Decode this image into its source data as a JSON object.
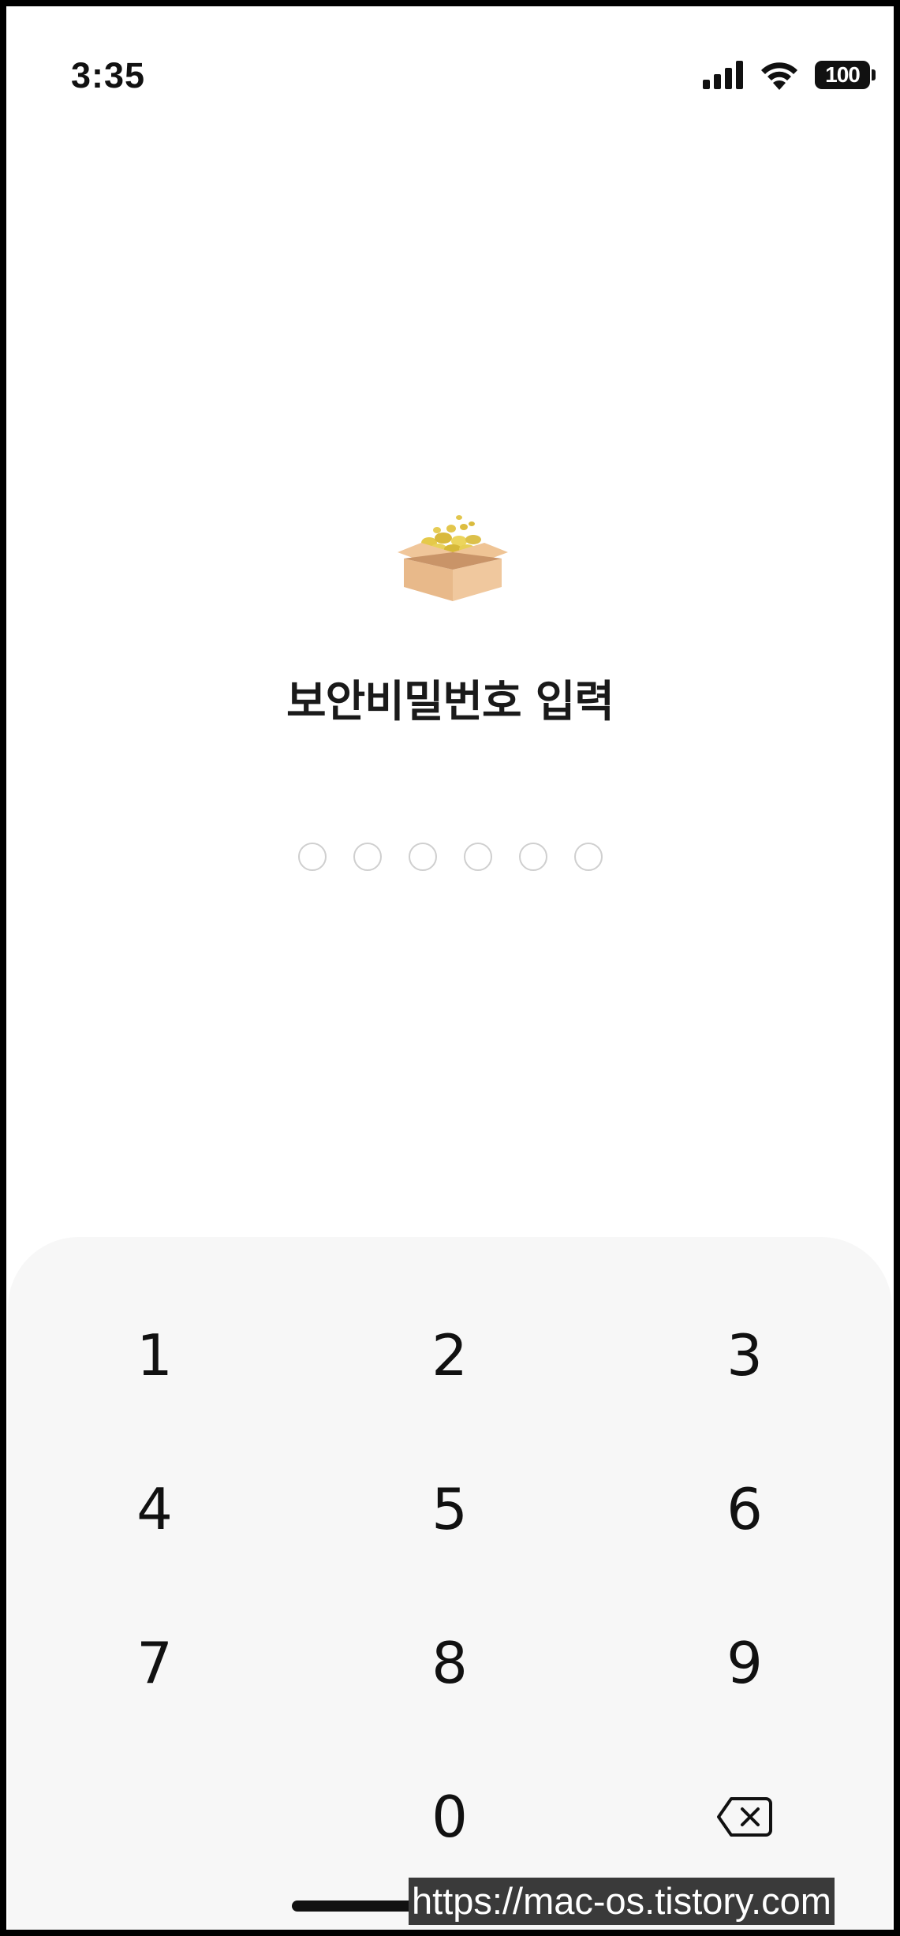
{
  "status_bar": {
    "time": "3:35",
    "battery": "100"
  },
  "page": {
    "title": "보안비밀번호 입력",
    "pin_length": 6
  },
  "keypad": {
    "keys": [
      "1",
      "2",
      "3",
      "4",
      "5",
      "6",
      "7",
      "8",
      "9",
      "0"
    ],
    "backspace_icon": "backspace-icon"
  },
  "icons": {
    "hero": "treasure-box-icon",
    "signal": "signal-icon",
    "wifi": "wifi-icon",
    "battery": "battery-icon"
  },
  "colors": {
    "keypad_background": "#f7f7f7",
    "pin_dot_border": "#cfcfcf",
    "text": "#111111"
  },
  "watermark": "https://mac-os.tistory.com"
}
